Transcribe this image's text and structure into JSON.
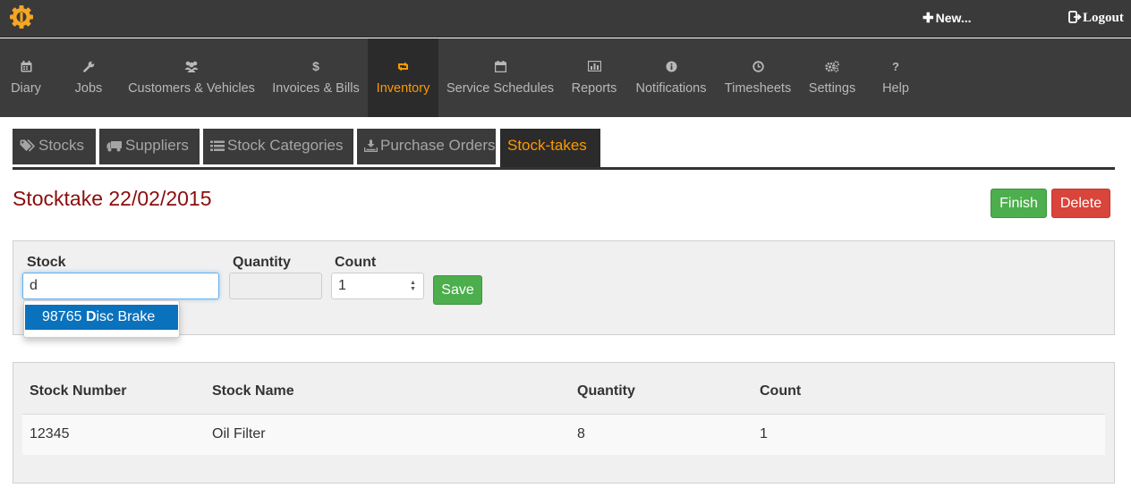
{
  "topbar": {
    "logo_icon": "gear-logo-icon",
    "new_label": "New...",
    "logout_label": "Logout"
  },
  "nav": {
    "items": [
      {
        "label": "Diary",
        "icon": "calendar-icon"
      },
      {
        "label": "Jobs",
        "icon": "wrench-icon"
      },
      {
        "label": "Customers & Vehicles",
        "icon": "users-icon"
      },
      {
        "label": "Invoices & Bills",
        "icon": "dollar-icon"
      },
      {
        "label": "Inventory",
        "icon": "retweet-icon"
      },
      {
        "label": "Service Schedules",
        "icon": "calendar-icon"
      },
      {
        "label": "Reports",
        "icon": "bar-chart-icon"
      },
      {
        "label": "Notifications",
        "icon": "info-icon"
      },
      {
        "label": "Timesheets",
        "icon": "clock-icon"
      },
      {
        "label": "Settings",
        "icon": "cogs-icon"
      },
      {
        "label": "Help",
        "icon": "question-icon"
      }
    ],
    "active": "Inventory"
  },
  "subtabs": {
    "items": [
      {
        "label": "Stocks",
        "icon": "tags-icon"
      },
      {
        "label": "Suppliers",
        "icon": "truck-icon"
      },
      {
        "label": "Stock Categories",
        "icon": "list-icon"
      },
      {
        "label": "Purchase Orders",
        "icon": "download-icon"
      },
      {
        "label": "Stock-takes",
        "icon": ""
      }
    ],
    "active": "Stock-takes"
  },
  "page": {
    "title": "Stocktake 22/02/2015",
    "finish_label": "Finish",
    "delete_label": "Delete"
  },
  "form": {
    "stock_label": "Stock",
    "stock_value": "d",
    "quantity_label": "Quantity",
    "quantity_value": "",
    "count_label": "Count",
    "count_value": "1",
    "save_label": "Save",
    "suggestion": {
      "prefix": "98765 ",
      "match": "D",
      "rest": "isc Brake"
    }
  },
  "table": {
    "headers": [
      "Stock Number",
      "Stock Name",
      "Quantity",
      "Count"
    ],
    "rows": [
      [
        "12345",
        "Oil Filter",
        "8",
        "1"
      ]
    ]
  },
  "colors": {
    "accent": "#ff9900",
    "title": "#8b0d0d",
    "success": "#4cae4c",
    "danger": "#d9443b",
    "highlight": "#0a72bd"
  }
}
